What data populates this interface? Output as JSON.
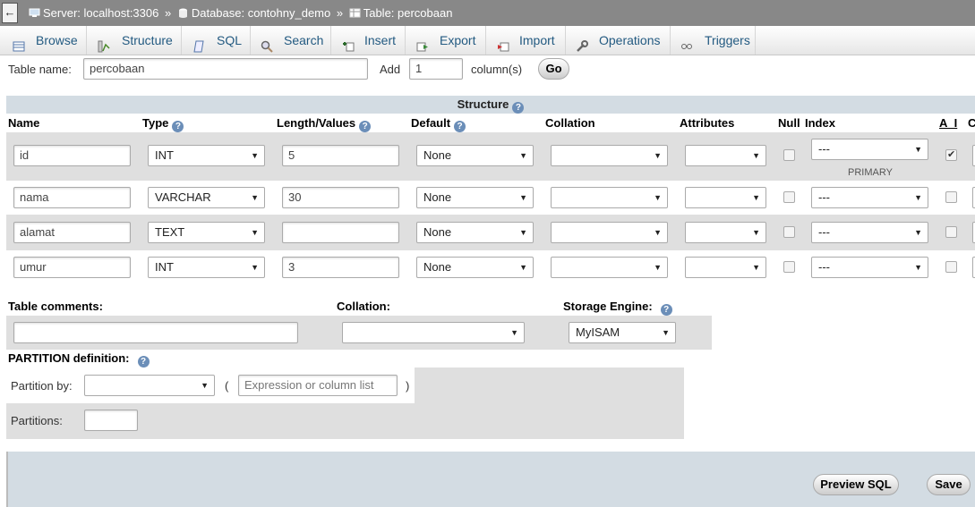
{
  "breadcrumb": {
    "back": "←",
    "server_label": "Server: localhost:3306",
    "database_label": "Database: contohny_demo",
    "table_label": "Table: percobaan",
    "separator": "»"
  },
  "tabs": [
    {
      "label": "Browse",
      "icon": "browse-icon"
    },
    {
      "label": "Structure",
      "icon": "structure-icon"
    },
    {
      "label": "SQL",
      "icon": "sql-icon"
    },
    {
      "label": "Search",
      "icon": "search-icon"
    },
    {
      "label": "Insert",
      "icon": "insert-icon"
    },
    {
      "label": "Export",
      "icon": "export-icon"
    },
    {
      "label": "Import",
      "icon": "import-icon"
    },
    {
      "label": "Operations",
      "icon": "wrench-icon"
    },
    {
      "label": "Triggers",
      "icon": "triggers-icon"
    }
  ],
  "table_form": {
    "name_label": "Table name:",
    "name_value": "percobaan",
    "add_label": "Add",
    "add_value": "1",
    "columns_label": "column(s)",
    "go_label": "Go"
  },
  "structure": {
    "title": "Structure",
    "headers": {
      "name": "Name",
      "type": "Type",
      "length": "Length/Values",
      "default": "Default",
      "collation": "Collation",
      "attributes": "Attributes",
      "null": "Null",
      "index": "Index",
      "ai": "A_I",
      "c": "C"
    },
    "rows": [
      {
        "name": "id",
        "type": "INT",
        "length": "5",
        "default": "None",
        "collation": "",
        "attributes": "",
        "null": false,
        "index": "---",
        "index_note": "PRIMARY",
        "ai": true
      },
      {
        "name": "nama",
        "type": "VARCHAR",
        "length": "30",
        "default": "None",
        "collation": "",
        "attributes": "",
        "null": false,
        "index": "---",
        "index_note": "",
        "ai": false
      },
      {
        "name": "alamat",
        "type": "TEXT",
        "length": "",
        "default": "None",
        "collation": "",
        "attributes": "",
        "null": false,
        "index": "---",
        "index_note": "",
        "ai": false
      },
      {
        "name": "umur",
        "type": "INT",
        "length": "3",
        "default": "None",
        "collation": "",
        "attributes": "",
        "null": false,
        "index": "---",
        "index_note": "",
        "ai": false
      }
    ]
  },
  "table_options": {
    "comments_label": "Table comments:",
    "comments_value": "",
    "collation_label": "Collation:",
    "collation_value": "",
    "engine_label": "Storage Engine:",
    "engine_value": "MyISAM"
  },
  "partition": {
    "title": "PARTITION definition:",
    "by_label": "Partition by:",
    "by_value": "",
    "open_paren": "(",
    "expression_placeholder": "Expression or column list",
    "close_paren": ")",
    "partitions_label": "Partitions:",
    "partitions_value": ""
  },
  "footer": {
    "preview_label": "Preview SQL",
    "save_label": "Save"
  }
}
